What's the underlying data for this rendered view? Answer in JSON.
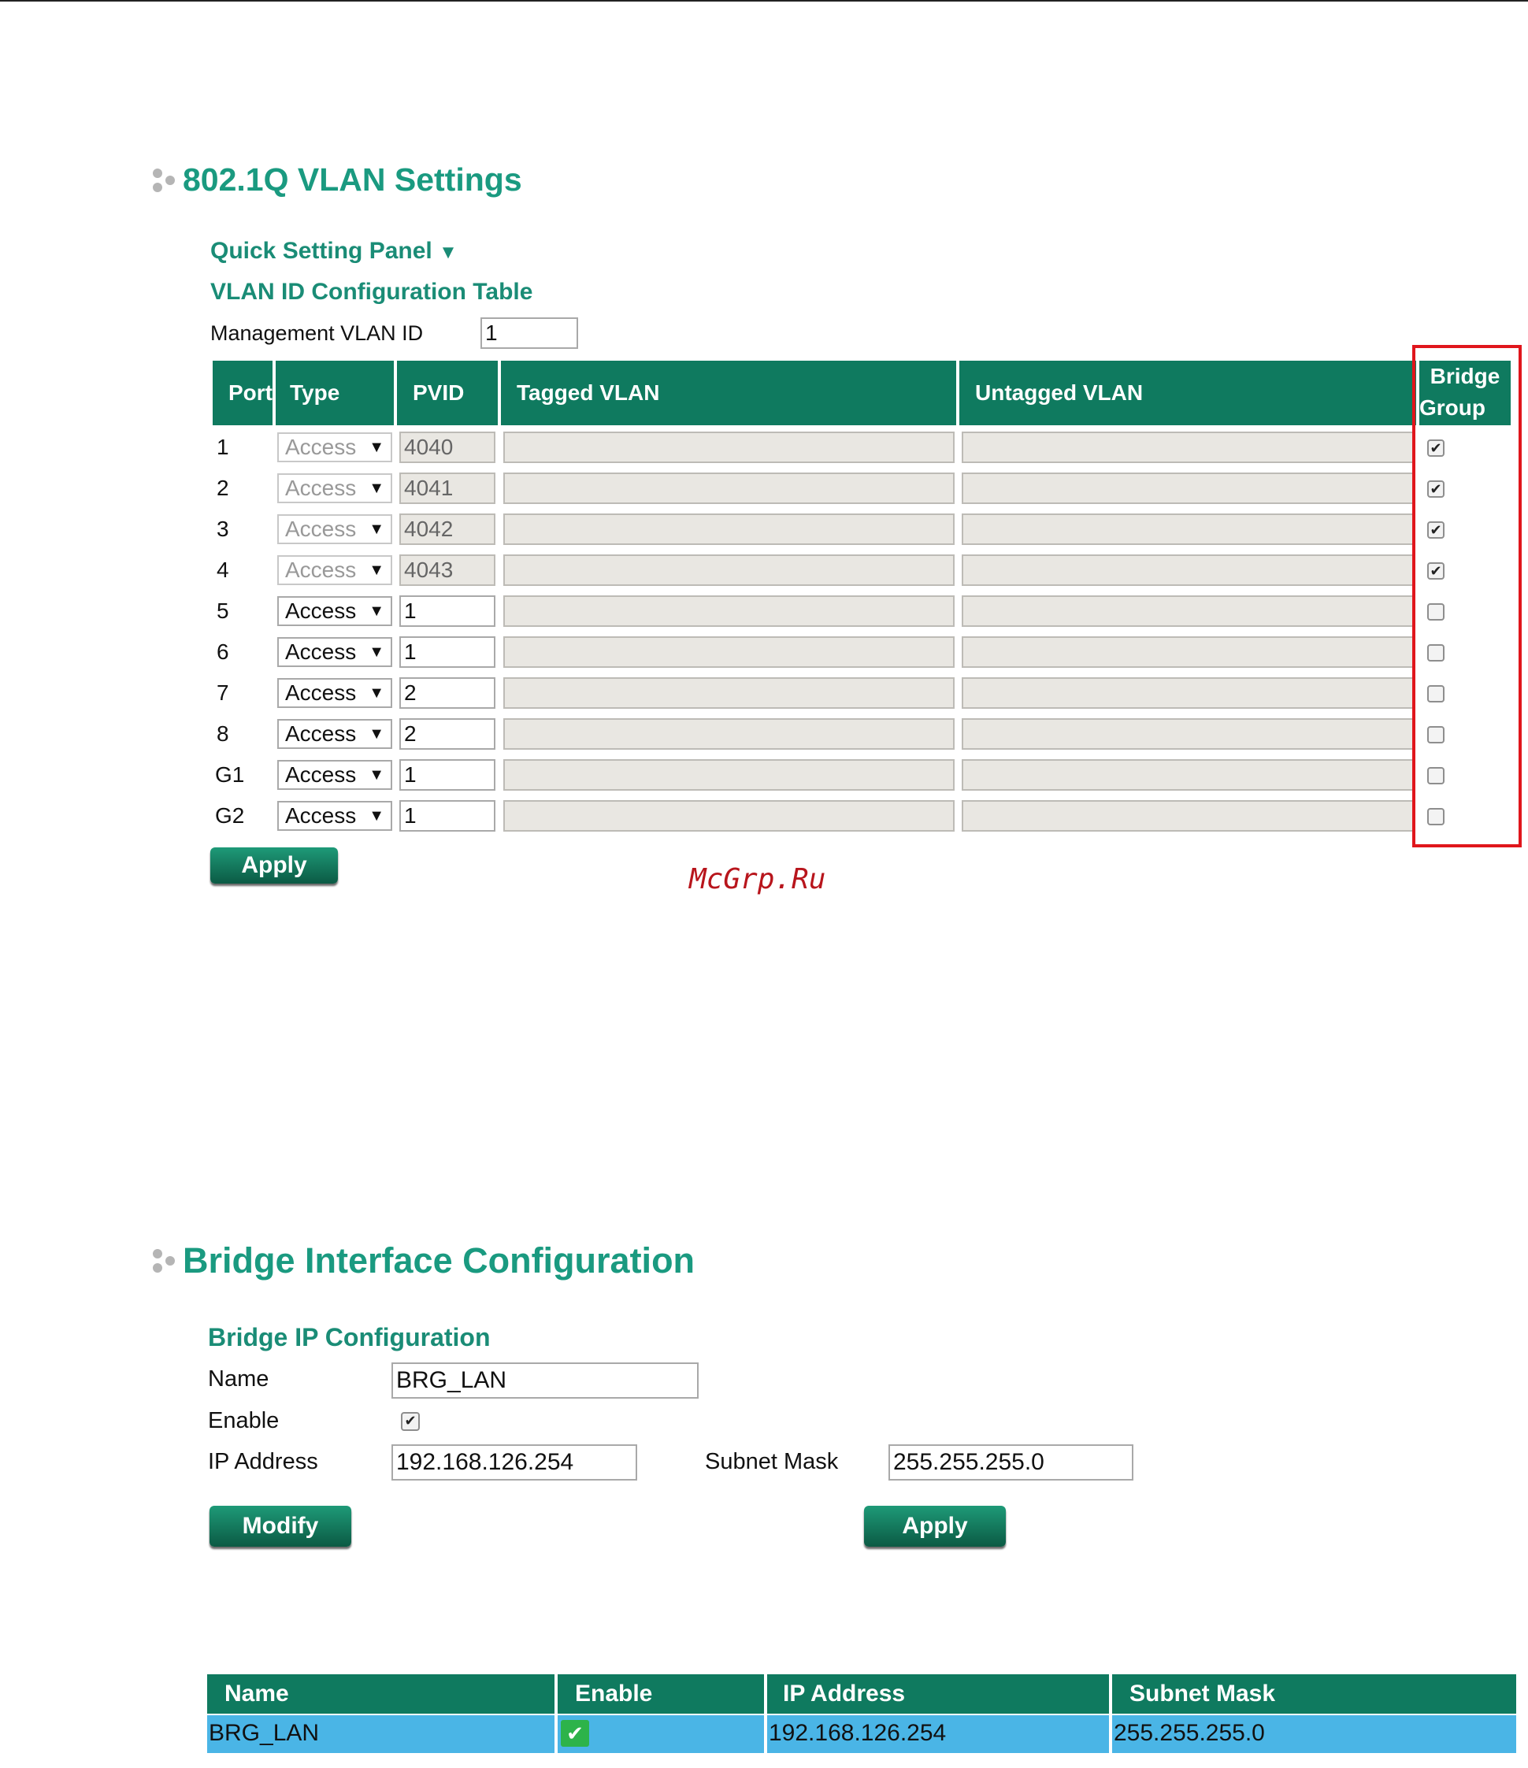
{
  "vlan_section": {
    "title": "802.1Q VLAN Settings",
    "quick_setting_panel": "Quick Setting Panel",
    "quick_setting_arrow": "▼",
    "table_title": "VLAN ID Configuration Table",
    "mgmt_label": "Management VLAN ID",
    "mgmt_value": "1",
    "columns": {
      "port": "Port",
      "type": "Type",
      "pvid": "PVID",
      "tagged": "Tagged VLAN",
      "untagged": "Untagged VLAN",
      "bridge_group_line1": "Bridge",
      "bridge_group_line2": "Group"
    },
    "rows": [
      {
        "port": "1",
        "type": "Access",
        "pvid": "4040",
        "tagged": "",
        "untagged": "",
        "bridge_group": true
      },
      {
        "port": "2",
        "type": "Access",
        "pvid": "4041",
        "tagged": "",
        "untagged": "",
        "bridge_group": true
      },
      {
        "port": "3",
        "type": "Access",
        "pvid": "4042",
        "tagged": "",
        "untagged": "",
        "bridge_group": true
      },
      {
        "port": "4",
        "type": "Access",
        "pvid": "4043",
        "tagged": "",
        "untagged": "",
        "bridge_group": true
      },
      {
        "port": "5",
        "type": "Access",
        "pvid": "1",
        "tagged": "",
        "untagged": "",
        "bridge_group": false
      },
      {
        "port": "6",
        "type": "Access",
        "pvid": "1",
        "tagged": "",
        "untagged": "",
        "bridge_group": false
      },
      {
        "port": "7",
        "type": "Access",
        "pvid": "2",
        "tagged": "",
        "untagged": "",
        "bridge_group": false
      },
      {
        "port": "8",
        "type": "Access",
        "pvid": "2",
        "tagged": "",
        "untagged": "",
        "bridge_group": false
      },
      {
        "port": "G1",
        "type": "Access",
        "pvid": "1",
        "tagged": "",
        "untagged": "",
        "bridge_group": false
      },
      {
        "port": "G2",
        "type": "Access",
        "pvid": "1",
        "tagged": "",
        "untagged": "",
        "bridge_group": false
      }
    ],
    "apply_label": "Apply"
  },
  "watermark": "McGrp.Ru",
  "bridge_section": {
    "title": "Bridge Interface Configuration",
    "subtitle": "Bridge IP Configuration",
    "name_label": "Name",
    "name_value": "BRG_LAN",
    "enable_label": "Enable",
    "enable_checked": true,
    "ip_label": "IP Address",
    "ip_value": "192.168.126.254",
    "mask_label": "Subnet Mask",
    "mask_value": "255.255.255.0",
    "modify_label": "Modify",
    "apply_label": "Apply",
    "table": {
      "columns": [
        "Name",
        "Enable",
        "IP Address",
        "Subnet Mask"
      ],
      "row": {
        "name": "BRG_LAN",
        "enable": "✔",
        "ip": "192.168.126.254",
        "mask": "255.255.255.0"
      }
    }
  },
  "colors": {
    "accent_green": "#1a9a80",
    "header_green": "#0f7a5f",
    "highlight_red": "#e0161c",
    "selected_row_blue": "#4ab5e6"
  }
}
